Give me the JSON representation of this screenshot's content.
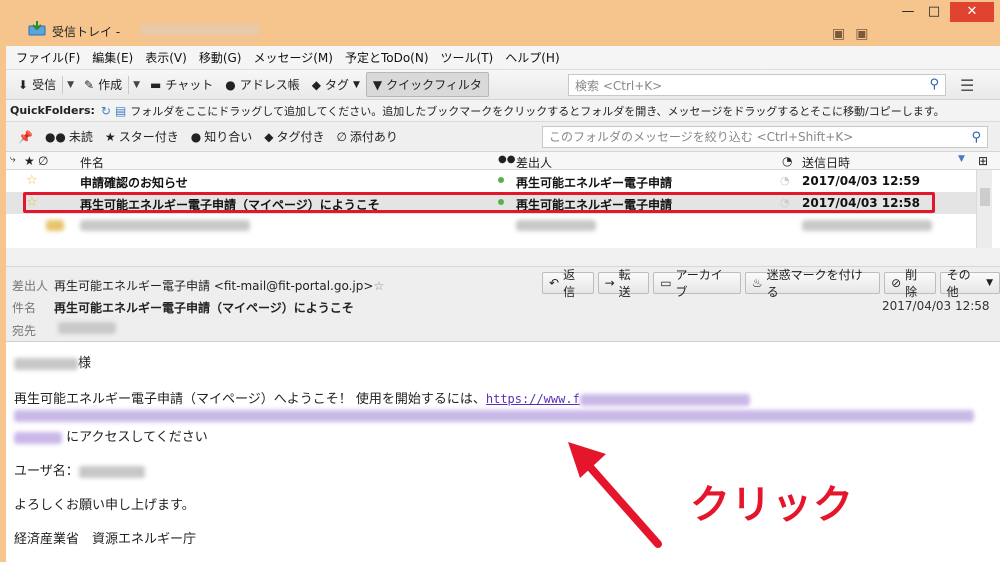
{
  "window": {
    "title": "受信トレイ -",
    "controls": {
      "minimize": "—",
      "maximize": "□",
      "close": "✕"
    }
  },
  "menu": [
    "ファイル(F)",
    "編集(E)",
    "表示(V)",
    "移動(G)",
    "メッセージ(M)",
    "予定とToDo(N)",
    "ツール(T)",
    "ヘルプ(H)"
  ],
  "toolbar": {
    "receive": "受信",
    "compose": "作成",
    "chat": "チャット",
    "address_book": "アドレス帳",
    "tag": "タグ",
    "quick_filter": "クイックフィルタ",
    "search_placeholder": "検索 <Ctrl+K>"
  },
  "quickfolders": {
    "label": "QuickFolders:",
    "hint": "フォルダをここにドラッグして追加してください。追加したブックマークをクリックするとフォルダを開き、メッセージをドラッグするとそこに移動/コピーします。"
  },
  "filterbar": {
    "unread": "未読",
    "starred": "スター付き",
    "contacts": "知り合い",
    "tagged": "タグ付き",
    "attachment": "添付あり",
    "search_placeholder": "このフォルダのメッセージを絞り込む <Ctrl+Shift+K>"
  },
  "columns": {
    "subject": "件名",
    "from": "差出人",
    "date": "送信日時"
  },
  "messages": [
    {
      "subject": "申請確認のお知らせ",
      "from": "再生可能エネルギー電子申請",
      "date": "2017/04/03 12:59"
    },
    {
      "subject": "再生可能エネルギー電子申請（マイページ）にようこそ",
      "from": "再生可能エネルギー電子申請",
      "date": "2017/04/03 12:58"
    }
  ],
  "header": {
    "from_label": "差出人",
    "from_value": "再生可能エネルギー電子申請 <fit-mail@fit-portal.go.jp>",
    "subject_label": "件名",
    "subject_value": "再生可能エネルギー電子申請（マイページ）にようこそ",
    "to_label": "宛先",
    "date": "2017/04/03 12:58",
    "actions": {
      "reply": "返信",
      "forward": "転送",
      "archive": "アーカイブ",
      "junk": "迷惑マークを付ける",
      "delete": "削除",
      "other": "その他"
    }
  },
  "body": {
    "salutation_suffix": "様",
    "welcome": "再生可能エネルギー電子申請（マイページ）へようこそ！ 使用を開始するには、",
    "link_start": "https://www.f",
    "access": "にアクセスしてください",
    "username_label": "ユーザ名：",
    "regards": "よろしくお願い申し上げます。",
    "sender_org": "経済産業省　資源エネルギー庁"
  },
  "annotation": {
    "callout": "クリック",
    "color": "#e5162b"
  }
}
